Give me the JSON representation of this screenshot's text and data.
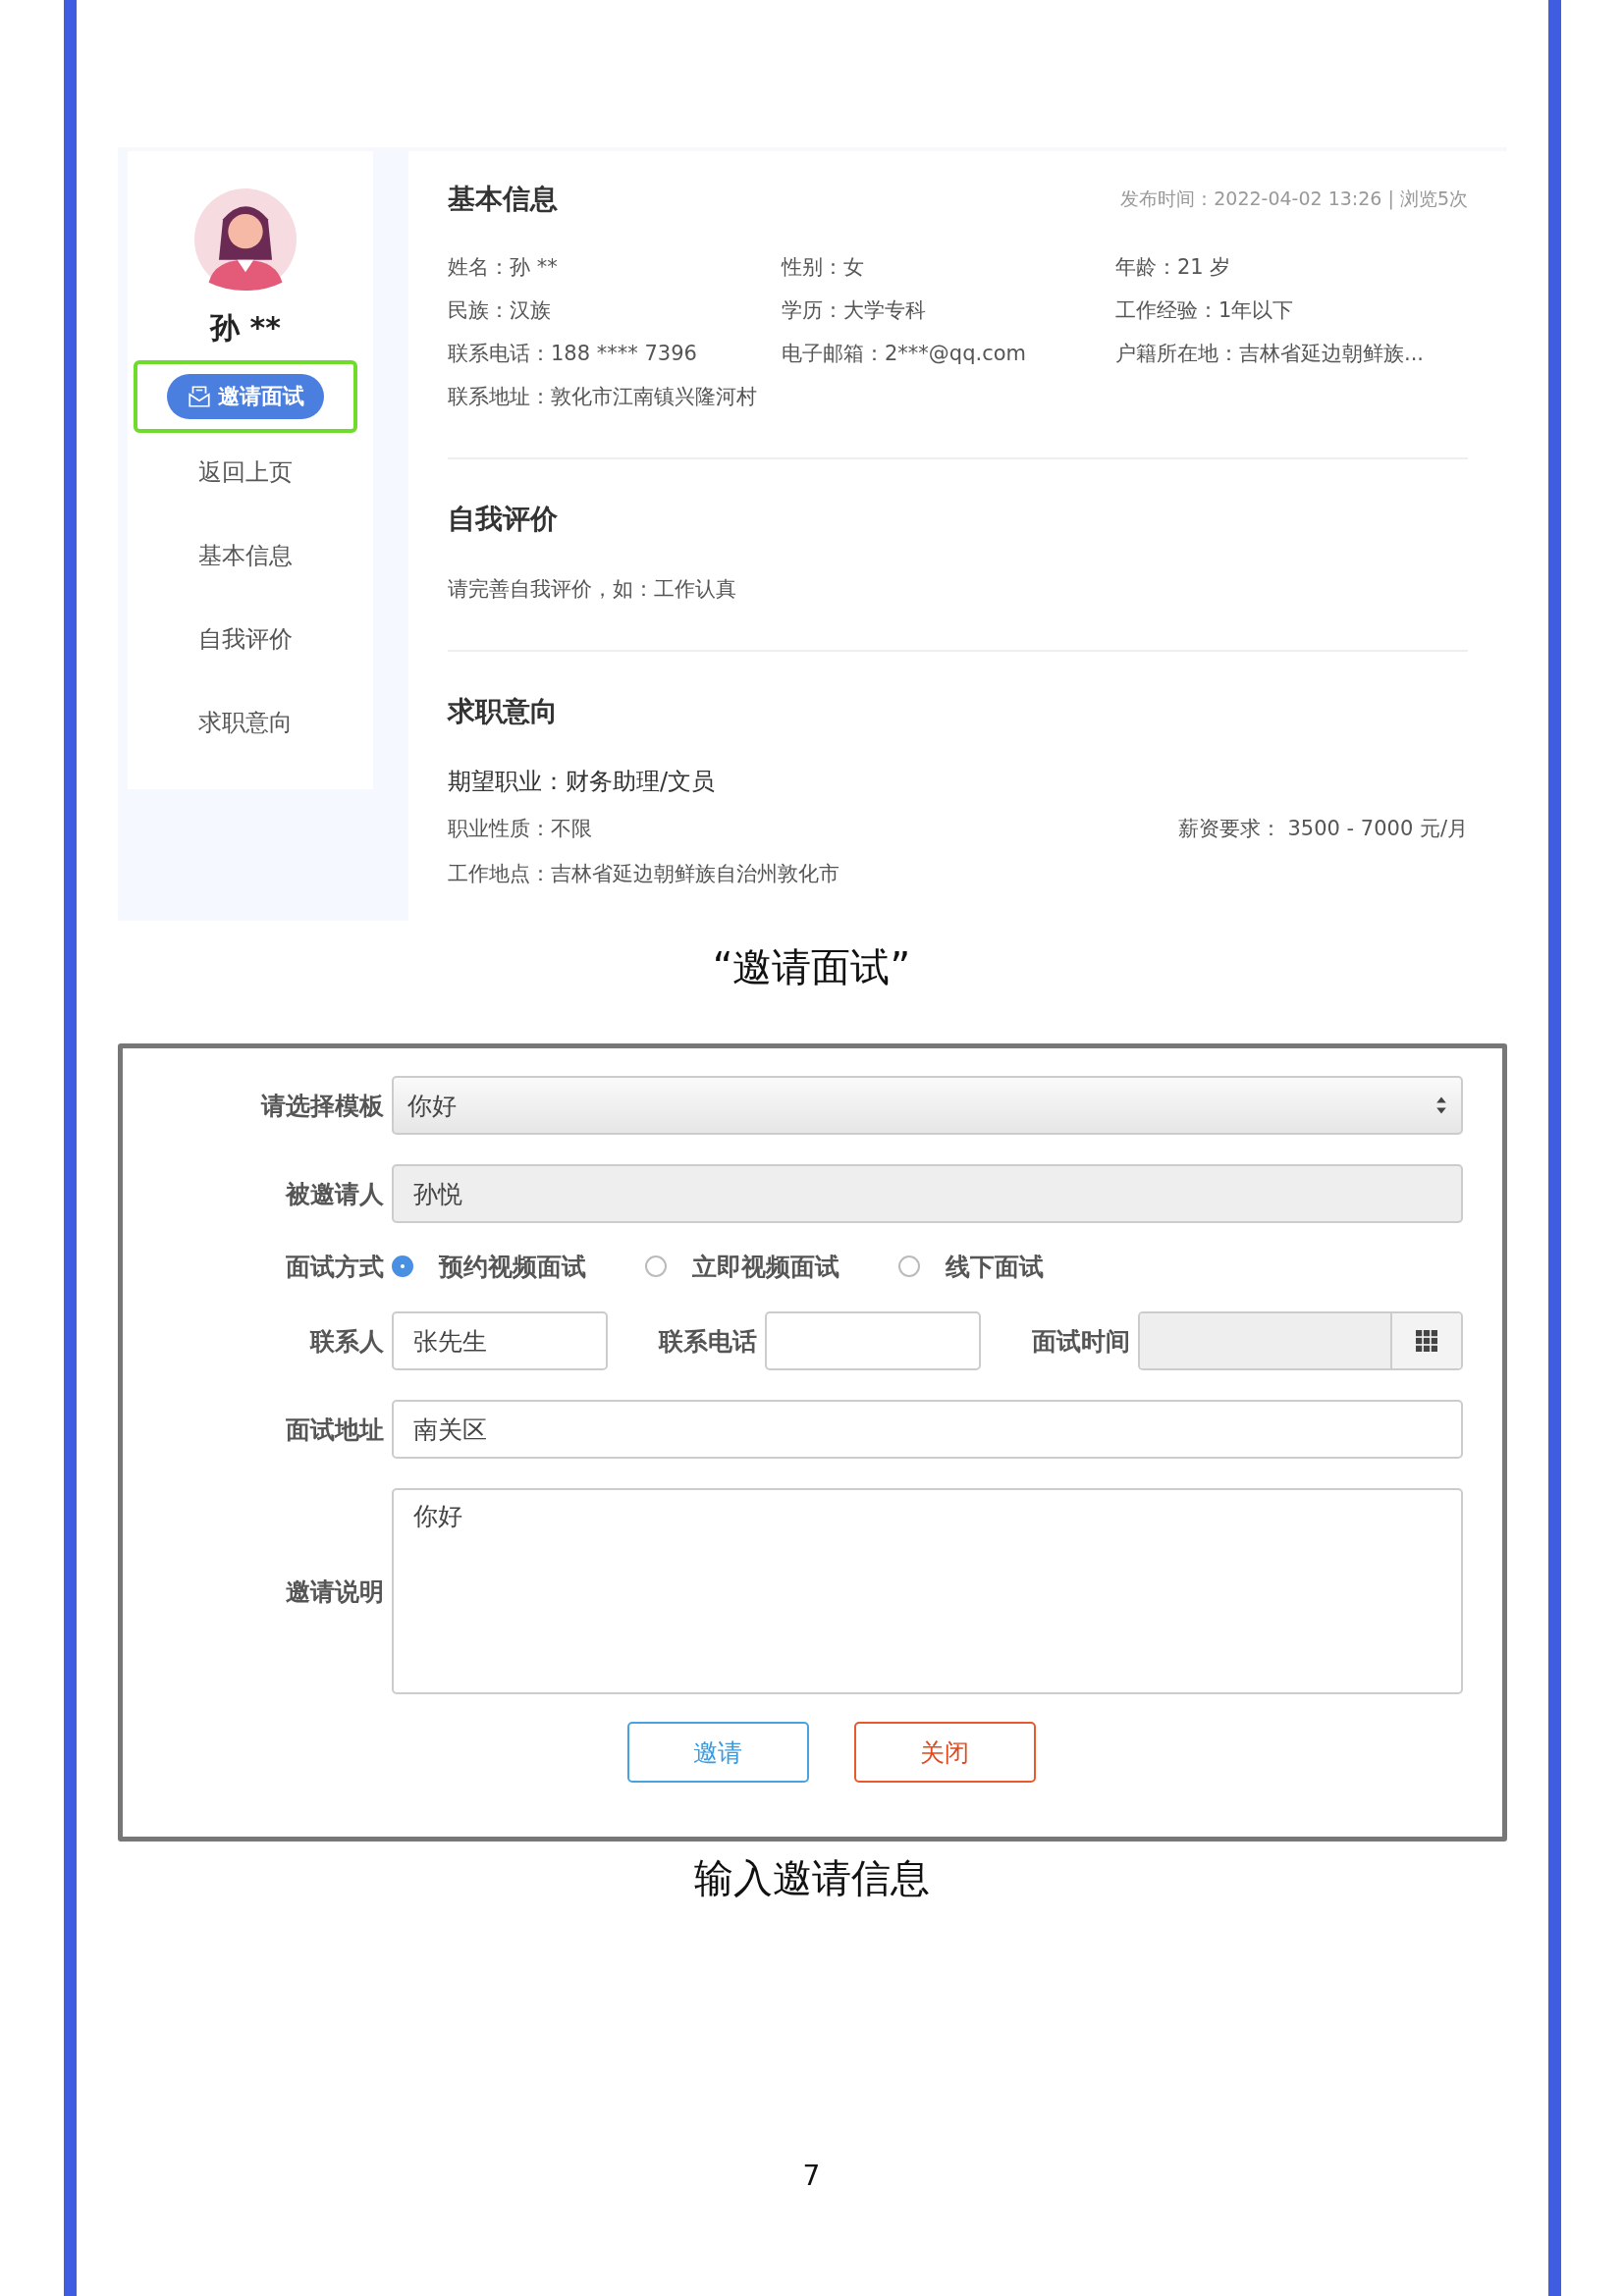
{
  "profile": {
    "name": "孙 **",
    "invite_button": "邀请面试",
    "highlighted": true,
    "nav": [
      "返回上页",
      "基本信息",
      "自我评价",
      "求职意向"
    ]
  },
  "basic_info": {
    "title": "基本信息",
    "meta": "发布时间：2022-04-02 13:26  |  浏览5次",
    "fields": [
      "姓名：孙 **",
      "性别：女",
      "年龄：21 岁",
      "民族：汉族",
      "学历：大学专科",
      "工作经验：1年以下",
      "联系电话：188 **** 7396",
      "电子邮箱：2***@qq.com",
      "户籍所在地：吉林省延边朝鲜族...",
      "联系地址：敦化市江南镇兴隆河村"
    ]
  },
  "self_evaluation": {
    "title": "自我评价",
    "text": "请完善自我评价，如：工作认真"
  },
  "job_intention": {
    "title": "求职意向",
    "occupation": "期望职业：财务助理/文员",
    "nature": "职业性质：不限",
    "salary": "薪资要求： 3500 - 7000 元/月",
    "location": "工作地点：吉林省延边朝鲜族自治州敦化市"
  },
  "caption_1": "“邀请面试”",
  "dialog": {
    "template": {
      "label": "请选择模板",
      "value": "你好"
    },
    "invitee": {
      "label": "被邀请人",
      "value": "孙悦"
    },
    "interview_mode": {
      "label": "面试方式",
      "options": [
        {
          "label": "预约视频面试",
          "selected": true
        },
        {
          "label": "立即视频面试",
          "selected": false
        },
        {
          "label": "线下面试",
          "selected": false
        }
      ]
    },
    "contact": {
      "label": "联系人",
      "value": "张先生"
    },
    "phone": {
      "label": "联系电话"
    },
    "time": {
      "label": "面试时间"
    },
    "address": {
      "label": "面试地址",
      "value": "南关区"
    },
    "note": {
      "label": "邀请说明",
      "value": "你好"
    },
    "buttons": [
      {
        "label": "邀请",
        "kind": "primary"
      },
      {
        "label": "关闭",
        "kind": "danger"
      }
    ]
  },
  "caption_2": "输入邀请信息",
  "page_number": "7"
}
